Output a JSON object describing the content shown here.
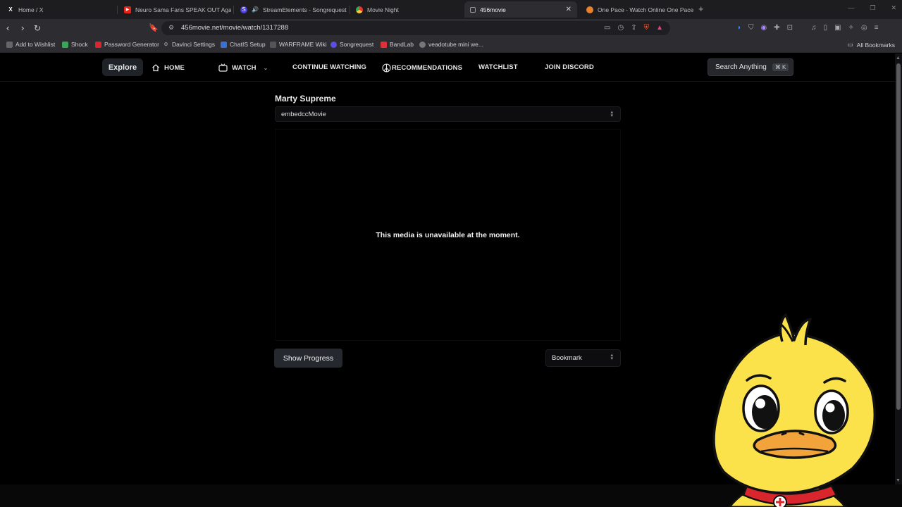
{
  "browser": {
    "tabs": [
      {
        "title": "Home / X",
        "icon": "x-logo-icon",
        "active": false
      },
      {
        "title": "Neuro Sama Fans SPEAK OUT Agains",
        "icon": "youtube-icon",
        "active": false
      },
      {
        "title": "StreamElements - Songrequest",
        "icon": "streamelements-icon",
        "active": false
      },
      {
        "title": "Movie Night",
        "icon": "chrome-icon",
        "active": false
      },
      {
        "title": "456movie",
        "icon": "page-icon",
        "active": true
      },
      {
        "title": "One Pace - Watch Online One Pace V",
        "icon": "onepace-icon",
        "active": false
      }
    ],
    "url": "456movie.net/movie/watch/1317288",
    "bookmarks": [
      {
        "label": "Add to Wishlist",
        "color": "#888888"
      },
      {
        "label": "Shock",
        "color": "#3aa655"
      },
      {
        "label": "Password Generator",
        "color": "#d9262c"
      },
      {
        "label": "Davinci Settings",
        "color": "#777777"
      },
      {
        "label": "ChatIS Setup",
        "color": "#3b6fd8"
      },
      {
        "label": "WARFRAME Wiki",
        "color": "#4a4a4a"
      },
      {
        "label": "Songrequest",
        "color": "#5a4fe0"
      },
      {
        "label": "BandLab",
        "color": "#e0313a"
      },
      {
        "label": "veadotube mini we...",
        "color": "#888888"
      }
    ],
    "all_bookmarks_label": "All Bookmarks"
  },
  "site": {
    "explore_label": "Explore",
    "nav": {
      "home": "HOME",
      "watch": "WATCH",
      "continue_watching": "CONTINUE WATCHING",
      "recommendations": "RECOMMENDATIONS",
      "watchlist": "WATCHLIST",
      "join_discord": "JOIN DISCORD"
    },
    "search": {
      "label": "Search Anything",
      "shortcut": "⌘ K"
    },
    "movie_title": "Marty Supreme",
    "source_select_value": "embedccMovie",
    "player_message": "This media is unavailable at the moment.",
    "show_progress_label": "Show Progress",
    "bookmark_select_value": "Bookmark"
  },
  "colors": {
    "page_bg": "#000000",
    "chrome_bg": "#2d2d31",
    "tabbar_bg": "#1d1d20",
    "button_bg": "#25292f",
    "mascot_yellow": "#fce24a",
    "mascot_beak": "#f2a33a"
  }
}
